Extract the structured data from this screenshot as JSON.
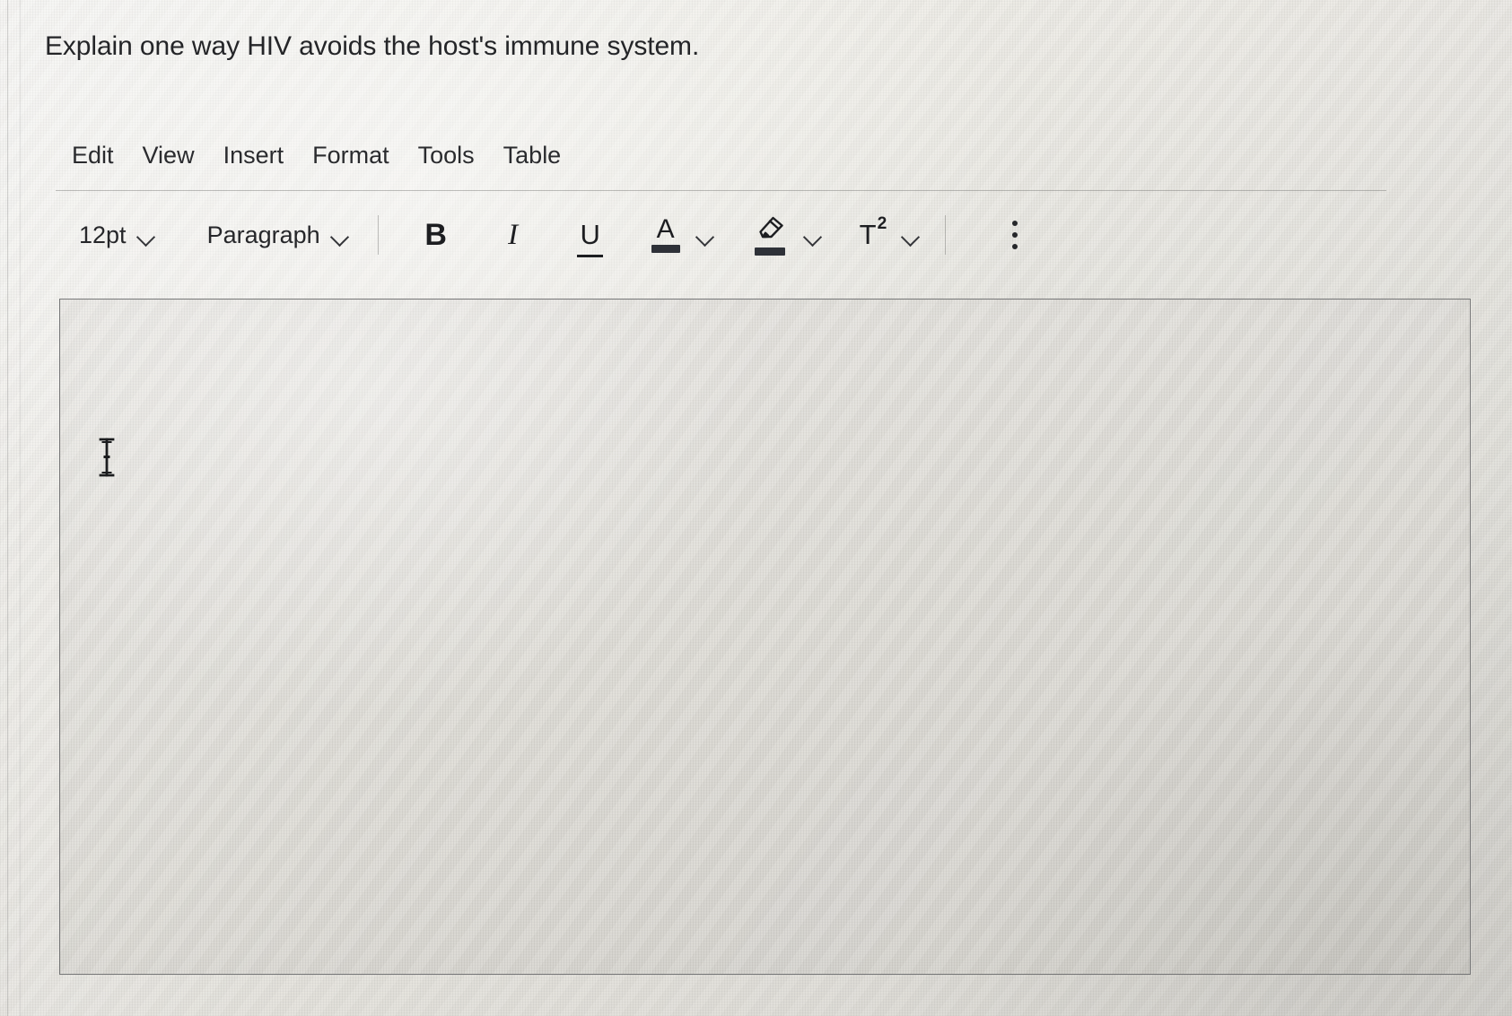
{
  "question": {
    "prompt": "Explain one way HIV avoids the host's immune system."
  },
  "editor": {
    "menubar": {
      "items": [
        {
          "label": "Edit",
          "name": "menu-edit"
        },
        {
          "label": "View",
          "name": "menu-view"
        },
        {
          "label": "Insert",
          "name": "menu-insert"
        },
        {
          "label": "Format",
          "name": "menu-format"
        },
        {
          "label": "Tools",
          "name": "menu-tools"
        },
        {
          "label": "Table",
          "name": "menu-table"
        }
      ]
    },
    "toolbar": {
      "font_size": {
        "value": "12pt",
        "icon": "chevron-down-icon"
      },
      "block_format": {
        "value": "Paragraph",
        "icon": "chevron-down-icon"
      },
      "bold": {
        "label": "B",
        "icon": "bold-icon"
      },
      "italic": {
        "label": "I",
        "icon": "italic-icon"
      },
      "underline": {
        "label": "U",
        "icon": "underline-icon"
      },
      "text_color": {
        "label": "A",
        "icon": "text-color-icon",
        "swatch_color": "#2e3138"
      },
      "text_color_chevron": {
        "icon": "chevron-down-icon"
      },
      "highlight": {
        "icon": "highlighter-icon",
        "swatch_color": "#2e3138"
      },
      "highlight_chevron": {
        "icon": "chevron-down-icon"
      },
      "superscript": {
        "label_base": "T",
        "label_sup": "2",
        "icon": "superscript-icon"
      },
      "superscript_chevron": {
        "icon": "chevron-down-icon"
      },
      "more_options": {
        "icon": "kebab-menu-icon"
      }
    },
    "answer_area": {
      "value": "",
      "placeholder": ""
    },
    "cursor": {
      "icon": "text-ibeam-cursor"
    }
  },
  "colors": {
    "page_background": "#eae8e3",
    "editor_background": "#dedcd6",
    "editor_border": "#585a5c",
    "text": "#242528"
  }
}
